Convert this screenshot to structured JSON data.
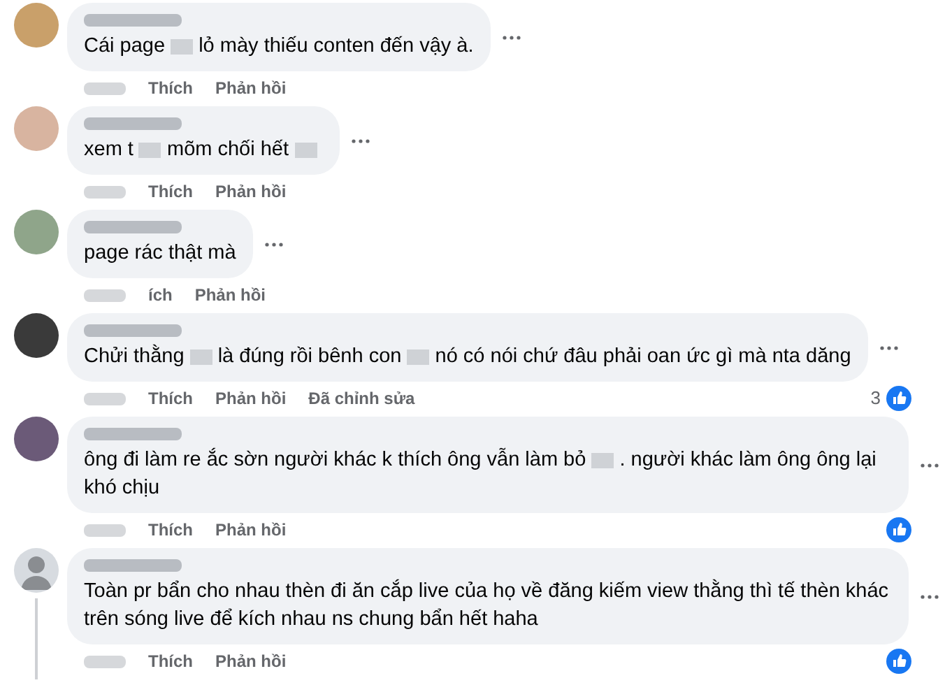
{
  "comments": [
    {
      "avatar": {
        "kind": "photo"
      },
      "thread_line": false,
      "body": [
        {
          "kind": "text",
          "text": "Cái page"
        },
        {
          "kind": "redacted"
        },
        {
          "kind": "text",
          "text": "lỏ mày thiếu conten đến vậy à."
        }
      ],
      "actions": [
        "Thích",
        "Phản hồi"
      ],
      "reaction_icon": false
    },
    {
      "avatar": {
        "kind": "photo"
      },
      "thread_line": false,
      "body": [
        {
          "kind": "text",
          "text": "xem t"
        },
        {
          "kind": "redacted"
        },
        {
          "kind": "text",
          "text": "mõm chối hết"
        },
        {
          "kind": "redacted"
        }
      ],
      "actions": [
        "Thích",
        "Phản hồi"
      ],
      "reaction_icon": false
    },
    {
      "avatar": {
        "kind": "photo"
      },
      "thread_line": false,
      "body": [
        {
          "kind": "text",
          "text": "page rác thật mà"
        }
      ],
      "actions": [
        "ích",
        "Phản hồi"
      ],
      "reaction_icon": false
    },
    {
      "avatar": {
        "kind": "photo"
      },
      "thread_line": false,
      "body": [
        {
          "kind": "text",
          "text": "Chửi thằng"
        },
        {
          "kind": "redacted"
        },
        {
          "kind": "text",
          "text": "là đúng rồi bênh con"
        },
        {
          "kind": "redacted"
        },
        {
          "kind": "text",
          "text": "nó có nói chứ đâu phải oan ức gì mà nta dăng"
        }
      ],
      "actions": [
        "Thích",
        "Phản hồi"
      ],
      "edited_label": "Đã chỉnh sửa",
      "reaction_icon": true,
      "reaction_count": "3"
    },
    {
      "avatar": {
        "kind": "photo"
      },
      "thread_line": false,
      "body": [
        {
          "kind": "text",
          "text": "ông đi làm re ắc sờn người khác k thích ông vẫn làm bỏ"
        },
        {
          "kind": "redacted"
        },
        {
          "kind": "text",
          "text": ". người khác làm ông ông lại khó chịu"
        }
      ],
      "actions": [
        "Thích",
        "Phản hồi"
      ],
      "reaction_icon": true
    },
    {
      "avatar": {
        "kind": "default"
      },
      "thread_line": true,
      "body": [
        {
          "kind": "text",
          "text": "Toàn pr bẩn cho nhau thèn đi ăn cắp live của họ về đăng kiếm view thằng thì tế thèn khác trên sóng live để kích nhau ns chung bẩn hết haha"
        }
      ],
      "actions": [
        "Thích",
        "Phản hồi"
      ],
      "reaction_icon": true
    }
  ]
}
